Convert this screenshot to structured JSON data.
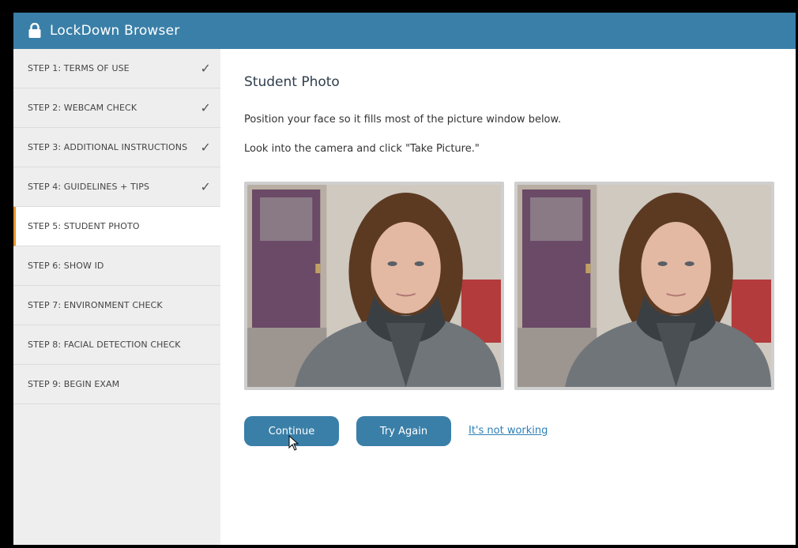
{
  "app": {
    "title": "LockDown Browser",
    "icon": "lock-icon",
    "accent": "#3a7fa8"
  },
  "sidebar": {
    "active_accent": "#e8942e",
    "steps": [
      {
        "label": "STEP 1: TERMS OF USE",
        "done": true
      },
      {
        "label": "STEP 2: WEBCAM CHECK",
        "done": true
      },
      {
        "label": "STEP 3: ADDITIONAL INSTRUCTIONS",
        "done": true
      },
      {
        "label": "STEP 4: GUIDELINES + TIPS",
        "done": true
      },
      {
        "label": "STEP 5: STUDENT PHOTO",
        "done": false,
        "active": true
      },
      {
        "label": "STEP 6: SHOW ID",
        "done": false
      },
      {
        "label": "STEP 7: ENVIRONMENT CHECK",
        "done": false
      },
      {
        "label": "STEP 8: FACIAL DETECTION CHECK",
        "done": false
      },
      {
        "label": "STEP 9: BEGIN EXAM",
        "done": false
      }
    ]
  },
  "main": {
    "heading": "Student Photo",
    "instruction_1": "Position your face so it fills most of the picture window below.",
    "instruction_2": "Look into the camera and click \"Take Picture.\"",
    "buttons": {
      "continue": "Continue",
      "try_again": "Try Again"
    },
    "link": "It's not working"
  }
}
